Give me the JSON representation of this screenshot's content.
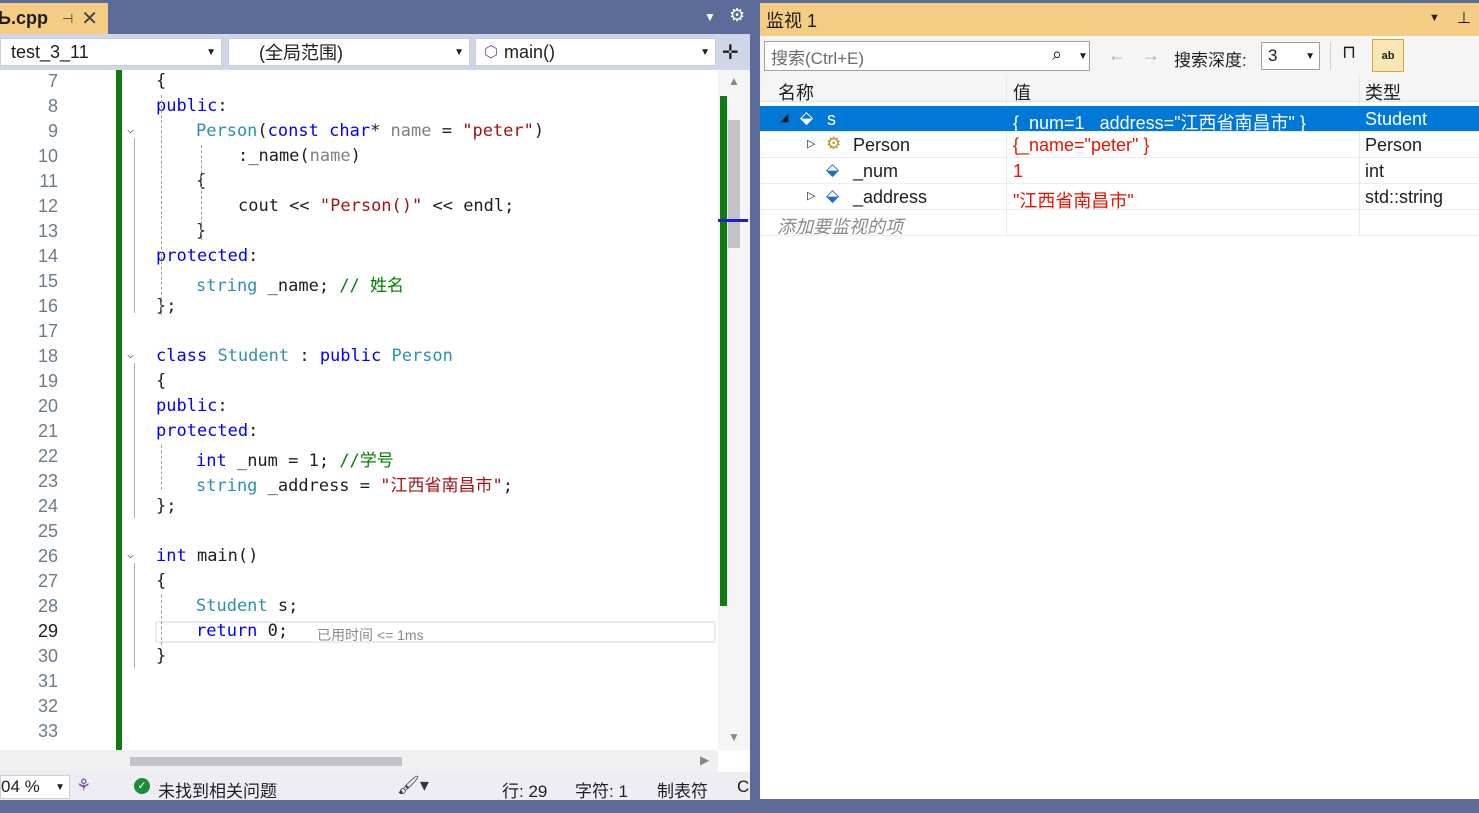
{
  "editor": {
    "tab": {
      "name": "Ь.cpp",
      "pin_glyph": "⊣",
      "close_glyph": "✕"
    },
    "nav": {
      "project": "test_3_11",
      "scope": "(全局范围)",
      "member": "main()"
    },
    "lines": [
      {
        "n": "7"
      },
      {
        "n": "8"
      },
      {
        "n": "9"
      },
      {
        "n": "10"
      },
      {
        "n": "11"
      },
      {
        "n": "12"
      },
      {
        "n": "13"
      },
      {
        "n": "14"
      },
      {
        "n": "15"
      },
      {
        "n": "16"
      },
      {
        "n": "17"
      },
      {
        "n": "18"
      },
      {
        "n": "19"
      },
      {
        "n": "20"
      },
      {
        "n": "21"
      },
      {
        "n": "22"
      },
      {
        "n": "23"
      },
      {
        "n": "24"
      },
      {
        "n": "25"
      },
      {
        "n": "26"
      },
      {
        "n": "27"
      },
      {
        "n": "28"
      },
      {
        "n": "29"
      },
      {
        "n": "30"
      },
      {
        "n": "31"
      },
      {
        "n": "32"
      },
      {
        "n": "33"
      }
    ],
    "code": {
      "l7": "{",
      "l8_kw": "public",
      "l8_rest": ":",
      "l9_fn": "Person",
      "l9_a": "(",
      "l9_const": "const",
      "l9_char": "char",
      "l9_b": "* ",
      "l9_name": "name",
      "l9_c": " = ",
      "l9_str": "\"peter\"",
      "l9_d": ")",
      "l10_a": ":_name(",
      "l10_name": "name",
      "l10_b": ")",
      "l11": "{",
      "l12_a": "cout << ",
      "l12_str": "\"Person()\"",
      "l12_b": " << endl;",
      "l13": "}",
      "l14_kw": "protected",
      "l14_rest": ":",
      "l15_ty": "string",
      "l15_a": " _name; ",
      "l15_cmt": "// 姓名",
      "l16": "};",
      "l18_kw": "class",
      "l18_ty": "Student",
      "l18_a": " : ",
      "l18_pub": "public",
      "l18_base": "Person",
      "l19": "{",
      "l20_kw": "public",
      "l20_rest": ":",
      "l21_kw": "protected",
      "l21_rest": ":",
      "l22_kw": "int",
      "l22_a": " _num = 1; ",
      "l22_cmt": "//学号",
      "l23_ty": "string",
      "l23_a": " _address = ",
      "l23_str": "\"江西省南昌市\"",
      "l23_b": ";",
      "l24": "};",
      "l26_kw": "int",
      "l26_a": " main()",
      "l27": "{",
      "l28_ty": "Student",
      "l28_a": " s;",
      "l29_kw": "return",
      "l29_a": " 0;",
      "perf_tip": "已用时间 <= 1ms",
      "l30": "}"
    },
    "status": {
      "zoom": "04 %",
      "issues": "未找到相关问题",
      "line": "行: 29",
      "col": "字符: 1",
      "indent": "制表符",
      "eol": "C"
    }
  },
  "watch": {
    "title": "监视 1",
    "search_placeholder": "搜索(Ctrl+E)",
    "depth_label": "搜索深度:",
    "depth_value": "3",
    "columns": {
      "name": "名称",
      "value": "值",
      "type": "类型"
    },
    "rows": [
      {
        "name": "s",
        "value": "{_num=1 _address=\"江西省南昌市\" }",
        "type": "Student"
      },
      {
        "name": "Person",
        "value": "{_name=\"peter\" }",
        "type": "Person"
      },
      {
        "name": "_num",
        "value": "1",
        "type": "int"
      },
      {
        "name": "_address",
        "value": "\"江西省南昌市\"",
        "type": "std::string"
      }
    ],
    "add_item": "添加要监视的项",
    "ab_label": "ab"
  }
}
